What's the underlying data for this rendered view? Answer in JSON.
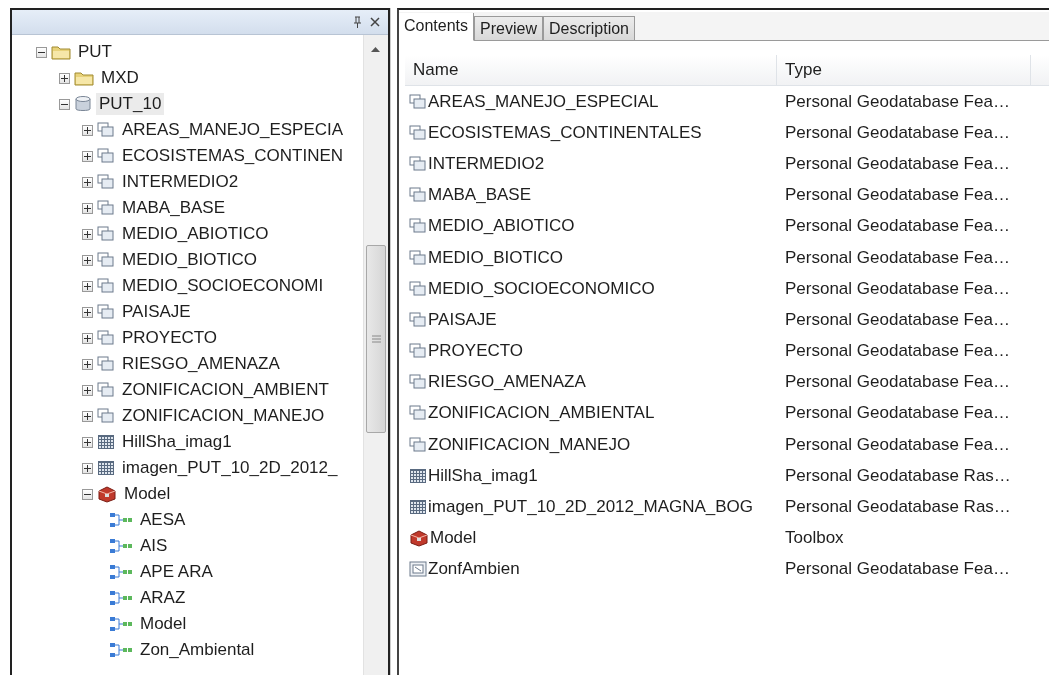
{
  "tree": [
    {
      "label": "PUT",
      "kind": "folder",
      "expanded": true,
      "selected": false,
      "children": [
        {
          "label": "MXD",
          "kind": "folder",
          "expanded": false,
          "selected": false
        },
        {
          "label": "PUT_10",
          "kind": "database",
          "expanded": true,
          "selected": true,
          "children": [
            {
              "label": "AREAS_MANEJO_ESPECIA",
              "kind": "feature",
              "expanded": false,
              "selected": false
            },
            {
              "label": "ECOSISTEMAS_CONTINEN",
              "kind": "feature",
              "expanded": false,
              "selected": false
            },
            {
              "label": "INTERMEDIO2",
              "kind": "feature",
              "expanded": false,
              "selected": false
            },
            {
              "label": "MABA_BASE",
              "kind": "feature",
              "expanded": false,
              "selected": false
            },
            {
              "label": "MEDIO_ABIOTICO",
              "kind": "feature",
              "expanded": false,
              "selected": false
            },
            {
              "label": "MEDIO_BIOTICO",
              "kind": "feature",
              "expanded": false,
              "selected": false
            },
            {
              "label": "MEDIO_SOCIOECONOMI",
              "kind": "feature",
              "expanded": false,
              "selected": false
            },
            {
              "label": "PAISAJE",
              "kind": "feature",
              "expanded": false,
              "selected": false
            },
            {
              "label": "PROYECTO",
              "kind": "feature",
              "expanded": false,
              "selected": false
            },
            {
              "label": "RIESGO_AMENAZA",
              "kind": "feature",
              "expanded": false,
              "selected": false
            },
            {
              "label": "ZONIFICACION_AMBIENT",
              "kind": "feature",
              "expanded": false,
              "selected": false
            },
            {
              "label": "ZONIFICACION_MANEJO",
              "kind": "feature",
              "expanded": false,
              "selected": false
            },
            {
              "label": "HillSha_imag1",
              "kind": "raster",
              "expanded": false,
              "selected": false
            },
            {
              "label": "imagen_PUT_10_2D_2012_",
              "kind": "raster",
              "expanded": false,
              "selected": false
            },
            {
              "label": "Model",
              "kind": "toolbox",
              "expanded": true,
              "selected": false,
              "children": [
                {
                  "label": "AESA",
                  "kind": "model",
                  "selected": false
                },
                {
                  "label": "AIS",
                  "kind": "model",
                  "selected": false
                },
                {
                  "label": "APE ARA",
                  "kind": "model",
                  "selected": false
                },
                {
                  "label": "ARAZ",
                  "kind": "model",
                  "selected": false
                },
                {
                  "label": "Model",
                  "kind": "model",
                  "selected": false
                },
                {
                  "label": "Zon_Ambiental",
                  "kind": "model",
                  "selected": false
                }
              ]
            }
          ]
        }
      ]
    }
  ],
  "tabs": [
    {
      "label": "Contents",
      "selected": true
    },
    {
      "label": "Preview",
      "selected": false
    },
    {
      "label": "Description",
      "selected": false
    }
  ],
  "table": {
    "columns": [
      "Name",
      "Type"
    ],
    "rows": [
      {
        "name": "AREAS_MANEJO_ESPECIAL",
        "kind": "feature",
        "type": "Personal Geodatabase Fea…"
      },
      {
        "name": "ECOSISTEMAS_CONTINENTALES",
        "kind": "feature",
        "type": "Personal Geodatabase Fea…"
      },
      {
        "name": "INTERMEDIO2",
        "kind": "feature",
        "type": "Personal Geodatabase Fea…"
      },
      {
        "name": "MABA_BASE",
        "kind": "feature",
        "type": "Personal Geodatabase Fea…"
      },
      {
        "name": "MEDIO_ABIOTICO",
        "kind": "feature",
        "type": "Personal Geodatabase Fea…"
      },
      {
        "name": "MEDIO_BIOTICO",
        "kind": "feature",
        "type": "Personal Geodatabase Fea…"
      },
      {
        "name": "MEDIO_SOCIOECONOMICO",
        "kind": "feature",
        "type": "Personal Geodatabase Fea…"
      },
      {
        "name": "PAISAJE",
        "kind": "feature",
        "type": "Personal Geodatabase Fea…"
      },
      {
        "name": "PROYECTO",
        "kind": "feature",
        "type": "Personal Geodatabase Fea…"
      },
      {
        "name": "RIESGO_AMENAZA",
        "kind": "feature",
        "type": "Personal Geodatabase Fea…"
      },
      {
        "name": "ZONIFICACION_AMBIENTAL",
        "kind": "feature",
        "type": "Personal Geodatabase Fea…"
      },
      {
        "name": "ZONIFICACION_MANEJO",
        "kind": "feature",
        "type": "Personal Geodatabase Fea…"
      },
      {
        "name": "HillSha_imag1",
        "kind": "raster",
        "type": "Personal Geodatabase Ras…"
      },
      {
        "name": "imagen_PUT_10_2D_2012_MAGNA_BOG",
        "kind": "raster",
        "type": "Personal Geodatabase Ras…"
      },
      {
        "name": "Model",
        "kind": "toolbox",
        "type": "Toolbox"
      },
      {
        "name": "ZonfAmbien",
        "kind": "table",
        "type": "Personal Geodatabase Fea…"
      }
    ]
  }
}
